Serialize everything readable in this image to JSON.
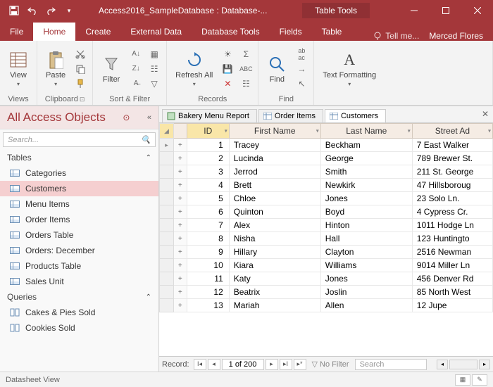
{
  "titlebar": {
    "title": "Access2016_SampleDatabase : Database-...",
    "context_tab": "Table Tools"
  },
  "ribbon_tabs": [
    "File",
    "Home",
    "Create",
    "External Data",
    "Database Tools",
    "Fields",
    "Table"
  ],
  "active_tab": "Home",
  "tell_me": "Tell me...",
  "user": "Merced Flores",
  "ribbon": {
    "view": "View",
    "paste": "Paste",
    "filter": "Filter",
    "refresh": "Refresh All",
    "find": "Find",
    "textfmt": "Text Formatting",
    "g_views": "Views",
    "g_clipboard": "Clipboard",
    "g_sortfilter": "Sort & Filter",
    "g_records": "Records",
    "g_find": "Find"
  },
  "navpane": {
    "title": "All Access Objects",
    "search_placeholder": "Search...",
    "sections": [
      {
        "name": "Tables",
        "items": [
          "Categories",
          "Customers",
          "Menu Items",
          "Order Items",
          "Orders Table",
          "Orders: December",
          "Products Table",
          "Sales Unit"
        ],
        "selected": "Customers"
      },
      {
        "name": "Queries",
        "items": [
          "Cakes & Pies Sold",
          "Cookies Sold"
        ]
      }
    ]
  },
  "doc_tabs": [
    {
      "label": "Bakery Menu Report",
      "type": "report"
    },
    {
      "label": "Order Items",
      "type": "table"
    },
    {
      "label": "Customers",
      "type": "table",
      "active": true
    }
  ],
  "datasheet": {
    "columns": [
      "ID",
      "First Name",
      "Last Name",
      "Street Ad"
    ],
    "rows": [
      {
        "id": 1,
        "first": "Tracey",
        "last": "Beckham",
        "street": "7 East Walker"
      },
      {
        "id": 2,
        "first": "Lucinda",
        "last": "George",
        "street": "789 Brewer St."
      },
      {
        "id": 3,
        "first": "Jerrod",
        "last": "Smith",
        "street": "211 St. George"
      },
      {
        "id": 4,
        "first": "Brett",
        "last": "Newkirk",
        "street": "47 Hillsboroug"
      },
      {
        "id": 5,
        "first": "Chloe",
        "last": "Jones",
        "street": "23 Solo Ln."
      },
      {
        "id": 6,
        "first": "Quinton",
        "last": "Boyd",
        "street": "4 Cypress Cr."
      },
      {
        "id": 7,
        "first": "Alex",
        "last": "Hinton",
        "street": "1011 Hodge Ln"
      },
      {
        "id": 8,
        "first": "Nisha",
        "last": "Hall",
        "street": "123 Huntingto"
      },
      {
        "id": 9,
        "first": "Hillary",
        "last": "Clayton",
        "street": "2516 Newman"
      },
      {
        "id": 10,
        "first": "Kiara",
        "last": "Williams",
        "street": "9014 Miller Ln"
      },
      {
        "id": 11,
        "first": "Katy",
        "last": "Jones",
        "street": "456 Denver Rd"
      },
      {
        "id": 12,
        "first": "Beatrix",
        "last": "Joslin",
        "street": "85 North West"
      },
      {
        "id": 13,
        "first": "Mariah",
        "last": "Allen",
        "street": "12 Jupe"
      }
    ]
  },
  "recnav": {
    "label": "Record:",
    "position": "1 of 200",
    "filter": "No Filter",
    "search": "Search"
  },
  "statusbar": {
    "view": "Datasheet View"
  }
}
